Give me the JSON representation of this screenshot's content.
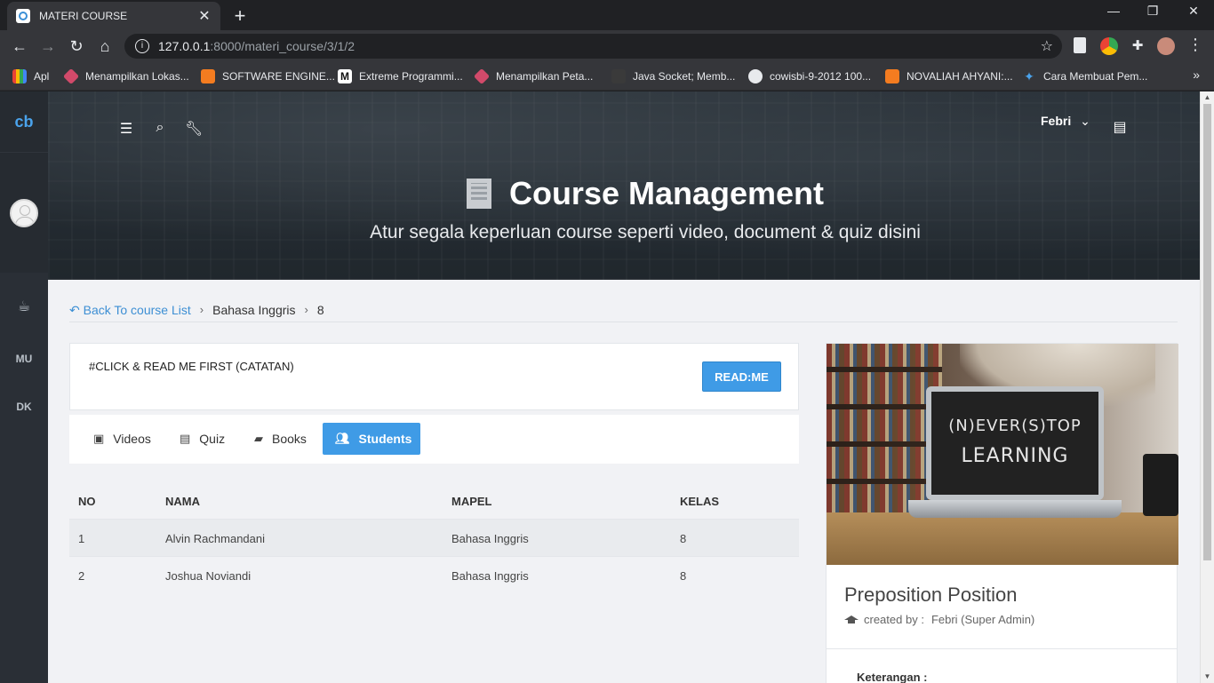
{
  "browser": {
    "tab_title": "MATERI COURSE",
    "url_host": "127.0.0.1",
    "url_path": ":8000/materi_course/3/1/2",
    "bookmarks": [
      {
        "label": "Apl",
        "color": "#e8553f"
      },
      {
        "label": "Menampilkan Lokas...",
        "color": "#d24a6a"
      },
      {
        "label": "SOFTWARE ENGINE...",
        "color": "#f47c20"
      },
      {
        "label": "Extreme Programmi...",
        "color": "#111111"
      },
      {
        "label": "Menampilkan Peta...",
        "color": "#d24a6a"
      },
      {
        "label": "Java Socket; Memb...",
        "color": "#3a3a3a"
      },
      {
        "label": "cowisbi-9-2012 100...",
        "color": "#9aa0a6"
      },
      {
        "label": "NOVALIAH AHYANI:...",
        "color": "#f47c20"
      },
      {
        "label": "Cara Membuat Pem...",
        "color": "#4aa3ec"
      }
    ]
  },
  "sidebar": {
    "logo": "cb",
    "items": [
      "MU",
      "DK"
    ]
  },
  "hero": {
    "user": "Febri",
    "title": "Course Management",
    "subtitle": "Atur segala keperluan course seperti video, document & quiz disini"
  },
  "breadcrumb": {
    "back": "Back To course List",
    "course": "Bahasa Inggris",
    "level": "8"
  },
  "notice": {
    "text": "#CLICK & READ ME FIRST (CATATAN)",
    "button": "READ:ME"
  },
  "tabs": [
    {
      "label": "Videos",
      "icon": "video-file-icon"
    },
    {
      "label": "Quiz",
      "icon": "document-icon"
    },
    {
      "label": "Books",
      "icon": "book-icon"
    },
    {
      "label": "Students",
      "icon": "users-icon",
      "active": true
    }
  ],
  "table": {
    "headers": [
      "NO",
      "NAMA",
      "MAPEL",
      "KELAS"
    ],
    "rows": [
      [
        "1",
        "Alvin Rachmandani",
        "Bahasa Inggris",
        "8"
      ],
      [
        "2",
        "Joshua Noviandi",
        "Bahasa Inggris",
        "8"
      ]
    ]
  },
  "card": {
    "image_text_line1": "(N)EVER(S)TOP",
    "image_text_line2": "LEARNING",
    "title": "Preposition Position",
    "meta_label": "created by :",
    "meta_value": "Febri (Super Admin)",
    "footer": "Keterangan :"
  },
  "colors": {
    "accent": "#3f9be6",
    "link": "#3d8fd4",
    "sidebar": "#2a2f36"
  }
}
